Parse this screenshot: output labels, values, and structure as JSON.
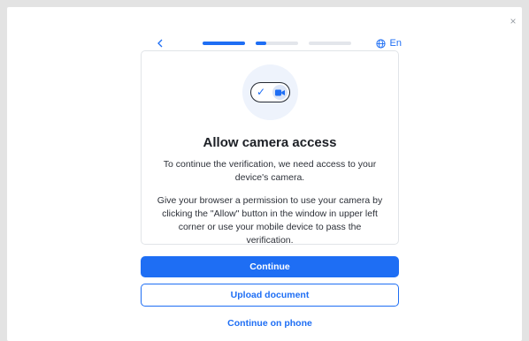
{
  "header": {
    "close_label": "×",
    "back_label": "<",
    "progress": [
      1.0,
      0.25,
      0.0
    ],
    "language": "En"
  },
  "card": {
    "title": "Allow camera access",
    "description": "To continue the verification, we need access to your device's camera.",
    "instructions": "Give your browser a permission to use your camera by clicking the \"Allow\" button in the window in upper left corner or use your mobile device to pass the verification."
  },
  "actions": {
    "continue_label": "Continue",
    "upload_label": "Upload document",
    "phone_label": "Continue on phone"
  },
  "colors": {
    "accent": "#1e6ef4",
    "track": "#e3e6eb",
    "text": "#1c1f25"
  }
}
